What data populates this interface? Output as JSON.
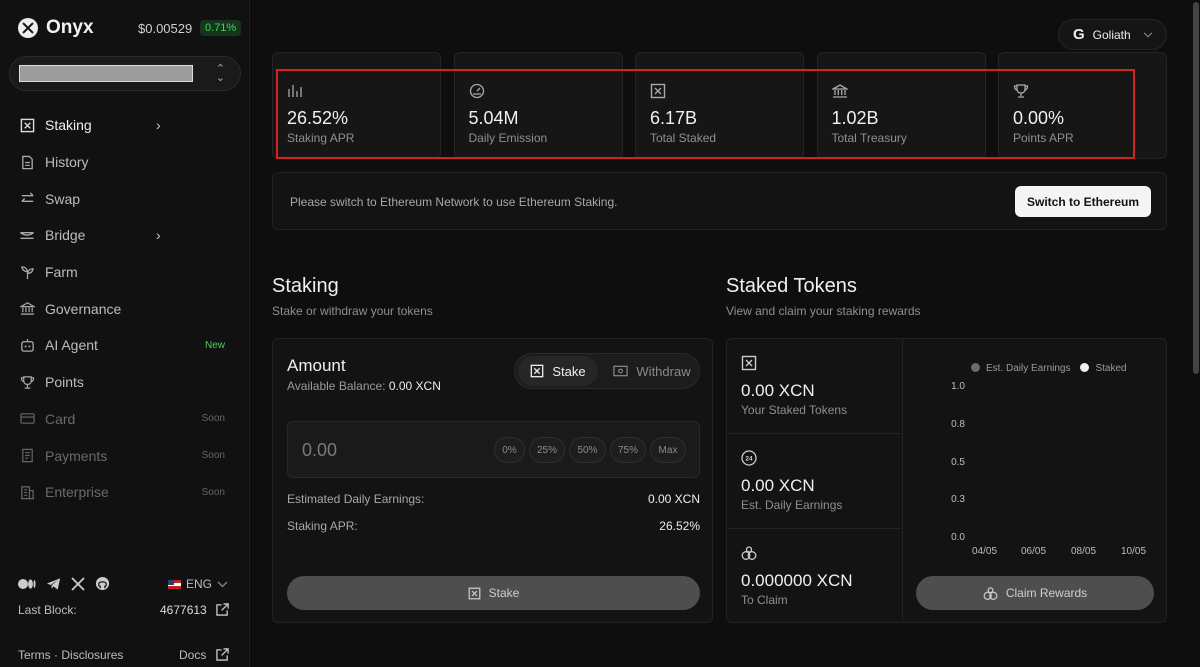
{
  "brand": {
    "name": "Onyx",
    "price": "$0.00529",
    "change": "0.71%"
  },
  "nav": [
    {
      "label": "Staking",
      "icon": "staking-icon",
      "chevron": "›"
    },
    {
      "label": "History",
      "icon": "history-icon"
    },
    {
      "label": "Swap",
      "icon": "swap-icon"
    },
    {
      "label": "Bridge",
      "icon": "bridge-icon",
      "chevron": "›"
    },
    {
      "label": "Farm",
      "icon": "farm-icon"
    },
    {
      "label": "Governance",
      "icon": "governance-icon"
    },
    {
      "label": "AI Agent",
      "icon": "ai-agent-icon",
      "badge": "New"
    },
    {
      "label": "Points",
      "icon": "trophy-icon"
    },
    {
      "label": "Card",
      "icon": "card-icon",
      "badge": "Soon"
    },
    {
      "label": "Payments",
      "icon": "payments-icon",
      "badge": "Soon"
    },
    {
      "label": "Enterprise",
      "icon": "enterprise-icon",
      "badge": "Soon"
    }
  ],
  "footer": {
    "language": "ENG",
    "last_block_label": "Last Block:",
    "last_block": "4677613",
    "terms": "Terms",
    "separator": "·",
    "disclosures": "Disclosures",
    "docs": "Docs"
  },
  "network": {
    "name": "Goliath",
    "initial": "G"
  },
  "stats": [
    {
      "value": "26.52%",
      "label": "Staking APR",
      "icon": "bar-chart-icon"
    },
    {
      "value": "5.04M",
      "label": "Daily Emission",
      "icon": "gauge-icon"
    },
    {
      "value": "6.17B",
      "label": "Total Staked",
      "icon": "staking-icon"
    },
    {
      "value": "1.02B",
      "label": "Total Treasury",
      "icon": "bank-icon"
    },
    {
      "value": "0.00%",
      "label": "Points APR",
      "icon": "trophy-icon"
    }
  ],
  "notice": {
    "text": "Please switch to Ethereum Network to use Ethereum Staking.",
    "button": "Switch to Ethereum"
  },
  "staking": {
    "title": "Staking",
    "subtitle": "Stake or withdraw your tokens",
    "amount_title": "Amount",
    "available_label": "Available Balance:",
    "available_value": "0.00 XCN",
    "tab_stake": "Stake",
    "tab_withdraw": "Withdraw",
    "input_placeholder": "0.00",
    "percent_buttons": [
      "0%",
      "25%",
      "50%",
      "75%",
      "Max"
    ],
    "est_label": "Estimated Daily Earnings:",
    "est_value": "0.00 XCN",
    "apr_label": "Staking APR:",
    "apr_value": "26.52%",
    "stake_button": "Stake"
  },
  "staked": {
    "title": "Staked Tokens",
    "subtitle": "View and claim your staking rewards",
    "items": [
      {
        "value": "0.00 XCN",
        "label": "Your Staked Tokens",
        "icon": "staking-icon"
      },
      {
        "value": "0.00 XCN",
        "label": "Est. Daily Earnings",
        "icon": "clock-24-icon"
      },
      {
        "value": "0.000000 XCN",
        "label": "To Claim",
        "icon": "coins-icon"
      }
    ],
    "claim_button": "Claim Rewards"
  },
  "chart_data": {
    "type": "line",
    "legend": [
      "Est. Daily Earnings",
      "Staked"
    ],
    "legend_colors": [
      "#6b6b6b",
      "#f0f0f0"
    ],
    "legend_position": "top-right",
    "y_ticks": [
      "1.0",
      "0.8",
      "0.5",
      "0.3",
      "0.0"
    ],
    "x_ticks": [
      "04/05",
      "06/05",
      "08/05",
      "10/05"
    ],
    "ylim": [
      0,
      1
    ],
    "series": []
  }
}
